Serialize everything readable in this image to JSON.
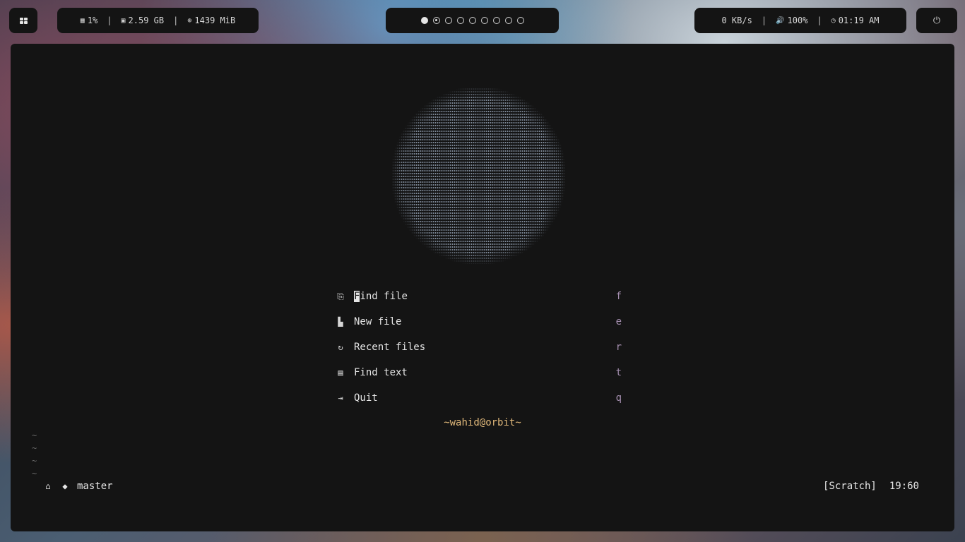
{
  "topbar": {
    "launcher_icon": "grid-icon",
    "stats": {
      "cpu": "1%",
      "disk": "2.59 GB",
      "memory": "1439 MiB",
      "separator": "|"
    },
    "workspaces": {
      "count": 9,
      "active_index": 0,
      "current_index": 1
    },
    "net": {
      "speed": "0 KB/s",
      "volume": "100%",
      "time": "01:19 AM",
      "separator": "|"
    },
    "power_icon": "power-icon"
  },
  "dashboard": {
    "menu": [
      {
        "first": "F",
        "rest": "ind file",
        "key": "f",
        "icon": "find-file-icon"
      },
      {
        "label": "New file",
        "key": "e",
        "icon": "new-file-icon"
      },
      {
        "label": "Recent files",
        "key": "r",
        "icon": "recent-files-icon"
      },
      {
        "label": "Find text",
        "key": "t",
        "icon": "find-text-icon"
      },
      {
        "label": "Quit",
        "key": "q",
        "icon": "quit-icon"
      }
    ],
    "footer": "~wahid@orbit~",
    "tilde": "~"
  },
  "statusline": {
    "branch": "master",
    "buffer": "[Scratch]",
    "position": "19:60"
  },
  "colors": {
    "panel": "#141414",
    "footer": "#e0b87a",
    "key": "#a58fb0"
  }
}
